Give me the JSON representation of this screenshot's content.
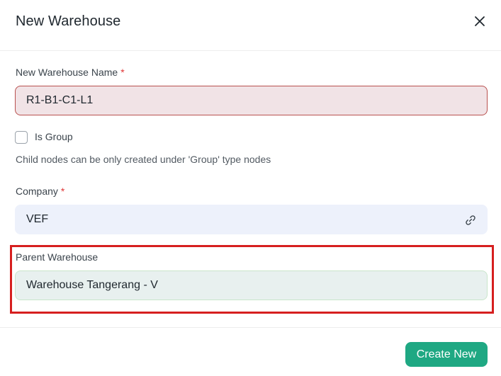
{
  "dialog": {
    "title": "New Warehouse",
    "close_icon": "close-icon"
  },
  "form": {
    "warehouse_name": {
      "label": "New Warehouse Name",
      "required_marker": "*",
      "value": "R1-B1-C1-L1"
    },
    "is_group": {
      "label": "Is Group",
      "checked": false,
      "help_text": "Child nodes can be only created under 'Group' type nodes"
    },
    "company": {
      "label": "Company",
      "required_marker": "*",
      "value": "VEF",
      "icon": "link-icon"
    },
    "parent_warehouse": {
      "label": "Parent Warehouse",
      "value": "Warehouse Tangerang - V"
    }
  },
  "footer": {
    "primary_label": "Create New"
  },
  "colors": {
    "primary_button": "#1fa883",
    "error_border": "#b9514f",
    "highlight_box": "#d61f1f",
    "required": "#e03636"
  }
}
